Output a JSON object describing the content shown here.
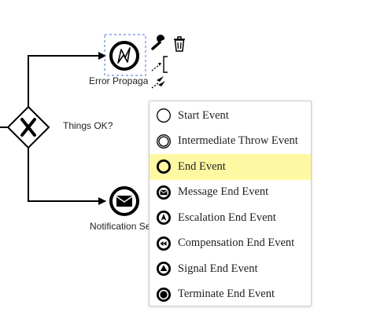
{
  "diagram": {
    "gateway_label": "Things OK?",
    "error_event_label": "Error Propagation",
    "notification_event_label": "Notification Sent"
  },
  "context_pad": {
    "icons": [
      "wrench-icon",
      "trash-icon",
      "connect-icon",
      "text-annotation-icon",
      "append-more-icon"
    ]
  },
  "popup_menu": {
    "items": [
      {
        "label": "Start Event",
        "icon": "start-event-icon"
      },
      {
        "label": "Intermediate Throw Event",
        "icon": "intermediate-throw-event-icon"
      },
      {
        "label": "End Event",
        "icon": "end-event-icon",
        "active": true
      },
      {
        "label": "Message End Event",
        "icon": "message-end-event-icon"
      },
      {
        "label": "Escalation End Event",
        "icon": "escalation-end-event-icon"
      },
      {
        "label": "Compensation End Event",
        "icon": "compensation-end-event-icon"
      },
      {
        "label": "Signal End Event",
        "icon": "signal-end-event-icon"
      },
      {
        "label": "Terminate End Event",
        "icon": "terminate-end-event-icon"
      }
    ],
    "highlight_color": "#fff8a3"
  }
}
